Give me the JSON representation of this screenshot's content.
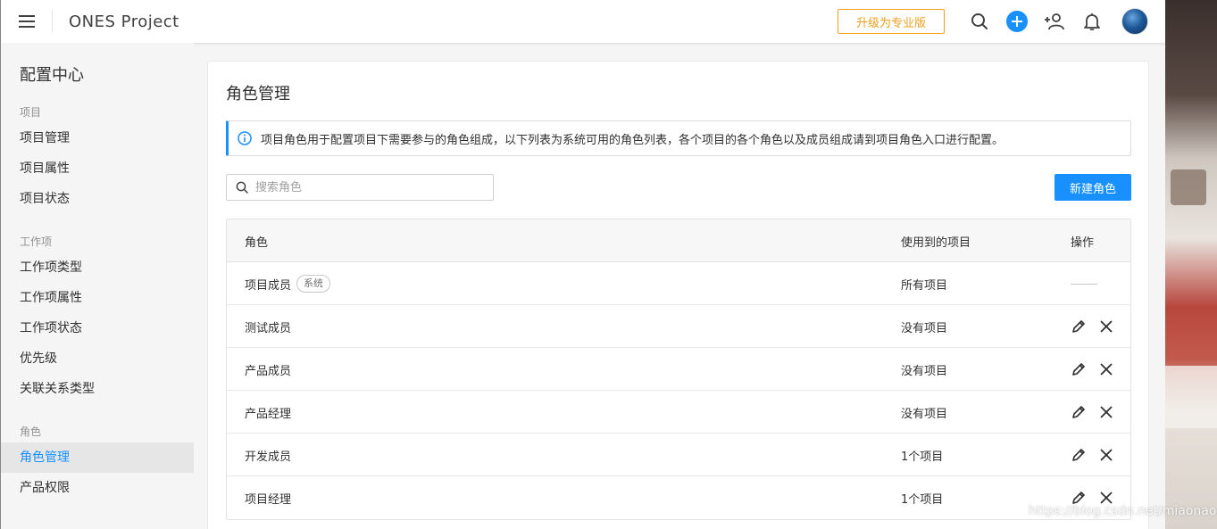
{
  "header": {
    "app_title": "ONES Project",
    "upgrade_label": "升级为专业版"
  },
  "sidebar": {
    "title": "配置中心",
    "groups": [
      {
        "label": "项目",
        "items": [
          "项目管理",
          "项目属性",
          "项目状态"
        ]
      },
      {
        "label": "工作项",
        "items": [
          "工作项类型",
          "工作项属性",
          "工作项状态",
          "优先级",
          "关联关系类型"
        ]
      },
      {
        "label": "角色",
        "items": [
          "角色管理",
          "产品权限"
        ]
      }
    ],
    "active_item": "角色管理"
  },
  "main": {
    "title": "角色管理",
    "notice": "项目角色用于配置项目下需要参与的角色组成，以下列表为系统可用的角色列表，各个项目的各个角色以及成员组成请到项目角色入口进行配置。",
    "search_placeholder": "搜索角色",
    "new_button": "新建角色",
    "table": {
      "headers": [
        "角色",
        "使用到的项目",
        "操作"
      ],
      "rows": [
        {
          "role": "项目成员",
          "tag": "系统",
          "projects": "所有项目",
          "editable": false
        },
        {
          "role": "测试成员",
          "tag": "",
          "projects": "没有项目",
          "editable": true
        },
        {
          "role": "产品成员",
          "tag": "",
          "projects": "没有项目",
          "editable": true
        },
        {
          "role": "产品经理",
          "tag": "",
          "projects": "没有项目",
          "editable": true
        },
        {
          "role": "开发成员",
          "tag": "",
          "projects": "1个项目",
          "editable": true
        },
        {
          "role": "项目经理",
          "tag": "",
          "projects": "1个项目",
          "editable": true
        }
      ]
    }
  },
  "watermark": "https://blog.csdn.net/miaonao",
  "colors": {
    "accent": "#1890ff",
    "upgrade": "#f0a020"
  }
}
